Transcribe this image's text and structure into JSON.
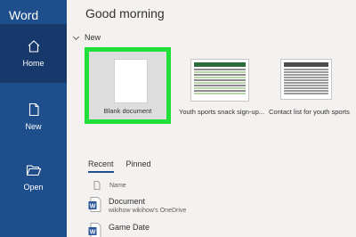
{
  "app": {
    "title": "Word"
  },
  "sidebar": {
    "items": [
      {
        "label": "Home",
        "icon": "home-icon"
      },
      {
        "label": "New",
        "icon": "new-document-icon"
      },
      {
        "label": "Open",
        "icon": "folder-open-icon"
      }
    ]
  },
  "main": {
    "greeting": "Good morning",
    "new_section": {
      "label": "New"
    },
    "templates": [
      {
        "label": "Blank document"
      },
      {
        "label": "Youth sports snack sign-up..."
      },
      {
        "label": "Contact list for youth sports"
      }
    ],
    "tabs": [
      {
        "label": "Recent"
      },
      {
        "label": "Pinned"
      }
    ],
    "list_header": {
      "name": "Name"
    },
    "files": [
      {
        "name": "Document",
        "location": "wikihow wikihow's OneDrive"
      },
      {
        "name": "Game Date",
        "location": ""
      }
    ]
  },
  "colors": {
    "sidebar": "#1f4e8c",
    "sidebar_active": "#17386a",
    "highlight": "#21e03a",
    "word_blue": "#2b579a"
  }
}
